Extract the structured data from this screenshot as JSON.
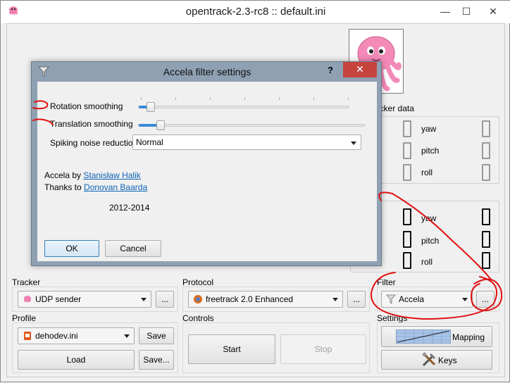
{
  "window": {
    "title": "opentrack-2.3-rc8 :: default.ini",
    "minimize": "—",
    "maximize": "☐",
    "close": "✕"
  },
  "tracker_data": {
    "label": "Tracker data",
    "axes": [
      "yaw",
      "pitch",
      "roll"
    ]
  },
  "game_data": {
    "axes": [
      "yaw",
      "pitch",
      "roll"
    ]
  },
  "tracker": {
    "label": "Tracker",
    "selected": "UDP sender",
    "more": "..."
  },
  "protocol": {
    "label": "Protocol",
    "selected": "freetrack 2.0 Enhanced",
    "more": "..."
  },
  "filter": {
    "label": "Filter",
    "selected": "Accela",
    "more": "..."
  },
  "profile": {
    "label": "Profile",
    "selected": "dehodev.ini",
    "save": "Save",
    "load": "Load",
    "save_as": "Save..."
  },
  "controls": {
    "label": "Controls",
    "start": "Start",
    "stop": "Stop"
  },
  "settings": {
    "label": "Settings",
    "mapping": "Mapping",
    "keys": "Keys"
  },
  "dialog": {
    "title": "Accela filter settings",
    "help": "?",
    "close": "✕",
    "rotation_label": "Rotation smoothing",
    "rotation_value": 0.04,
    "translation_label": "Translation smoothing",
    "translation_value": 0.08,
    "spiking_label": "Spiking noise reduction",
    "spiking_selected": "Normal",
    "credits_by_prefix": "Accela by",
    "credits_by_name": "Stanisław Halik",
    "credits_thanks_prefix": "Thanks to",
    "credits_thanks_name": "Donovan Baarda",
    "years": "2012-2014",
    "ok": "OK",
    "cancel": "Cancel"
  },
  "colors": {
    "accent": "#3c8ad8",
    "annotation": "#e01010",
    "close_red": "#c7443e",
    "link": "#0f63b8"
  }
}
